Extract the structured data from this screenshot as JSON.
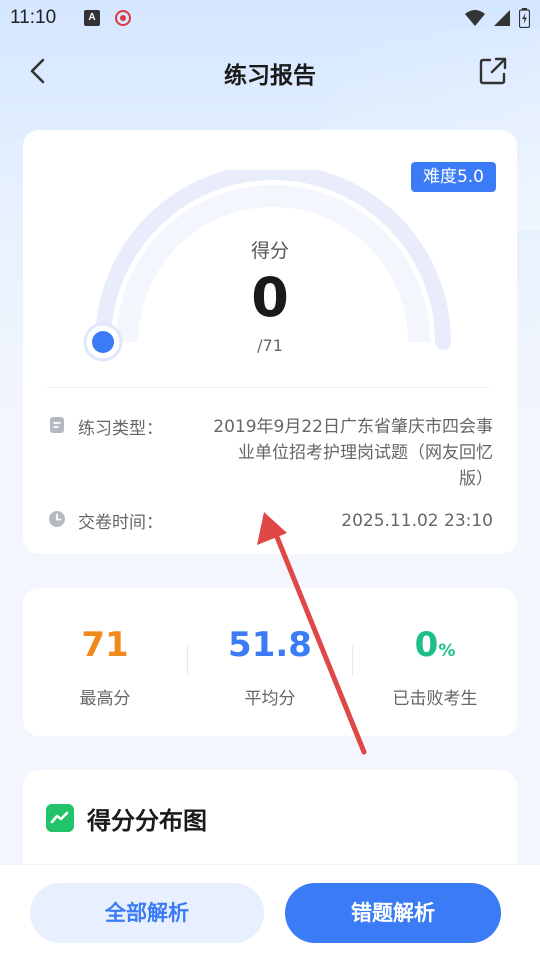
{
  "status_bar": {
    "time": "11:10",
    "icon_a_letter": "A",
    "icons": [
      "keyboard-a-icon",
      "record-icon",
      "wifi-icon",
      "signal-icon",
      "battery-icon"
    ]
  },
  "nav": {
    "title": "练习报告",
    "back_icon": "chevron-left-icon",
    "share_icon": "share-icon"
  },
  "score_card": {
    "difficulty": "难度5.0",
    "score_label": "得分",
    "score": "0",
    "total": "/71",
    "score_fraction": 0,
    "type_label": "练习类型：",
    "type_value": "2019年9月22日广东省肇庆市四会事业单位招考护理岗试题（网友回忆版）",
    "time_label": "交卷时间：",
    "time_value": "2025.11.02 23:10"
  },
  "stats": [
    {
      "value": "71",
      "unit": "",
      "label": "最高分",
      "color": "#f28a1b"
    },
    {
      "value": "51.8",
      "unit": "",
      "label": "平均分",
      "color": "#3b7cf6"
    },
    {
      "value": "0",
      "unit": "%",
      "label": "已击败考生",
      "color": "#1fbd8a"
    }
  ],
  "distribution": {
    "title": "得分分布图"
  },
  "buttons": {
    "all_analysis": "全部解析",
    "wrong_analysis": "错题解析"
  },
  "colors": {
    "accent": "#3b7cf6",
    "annotation_arrow": "#e04848"
  }
}
